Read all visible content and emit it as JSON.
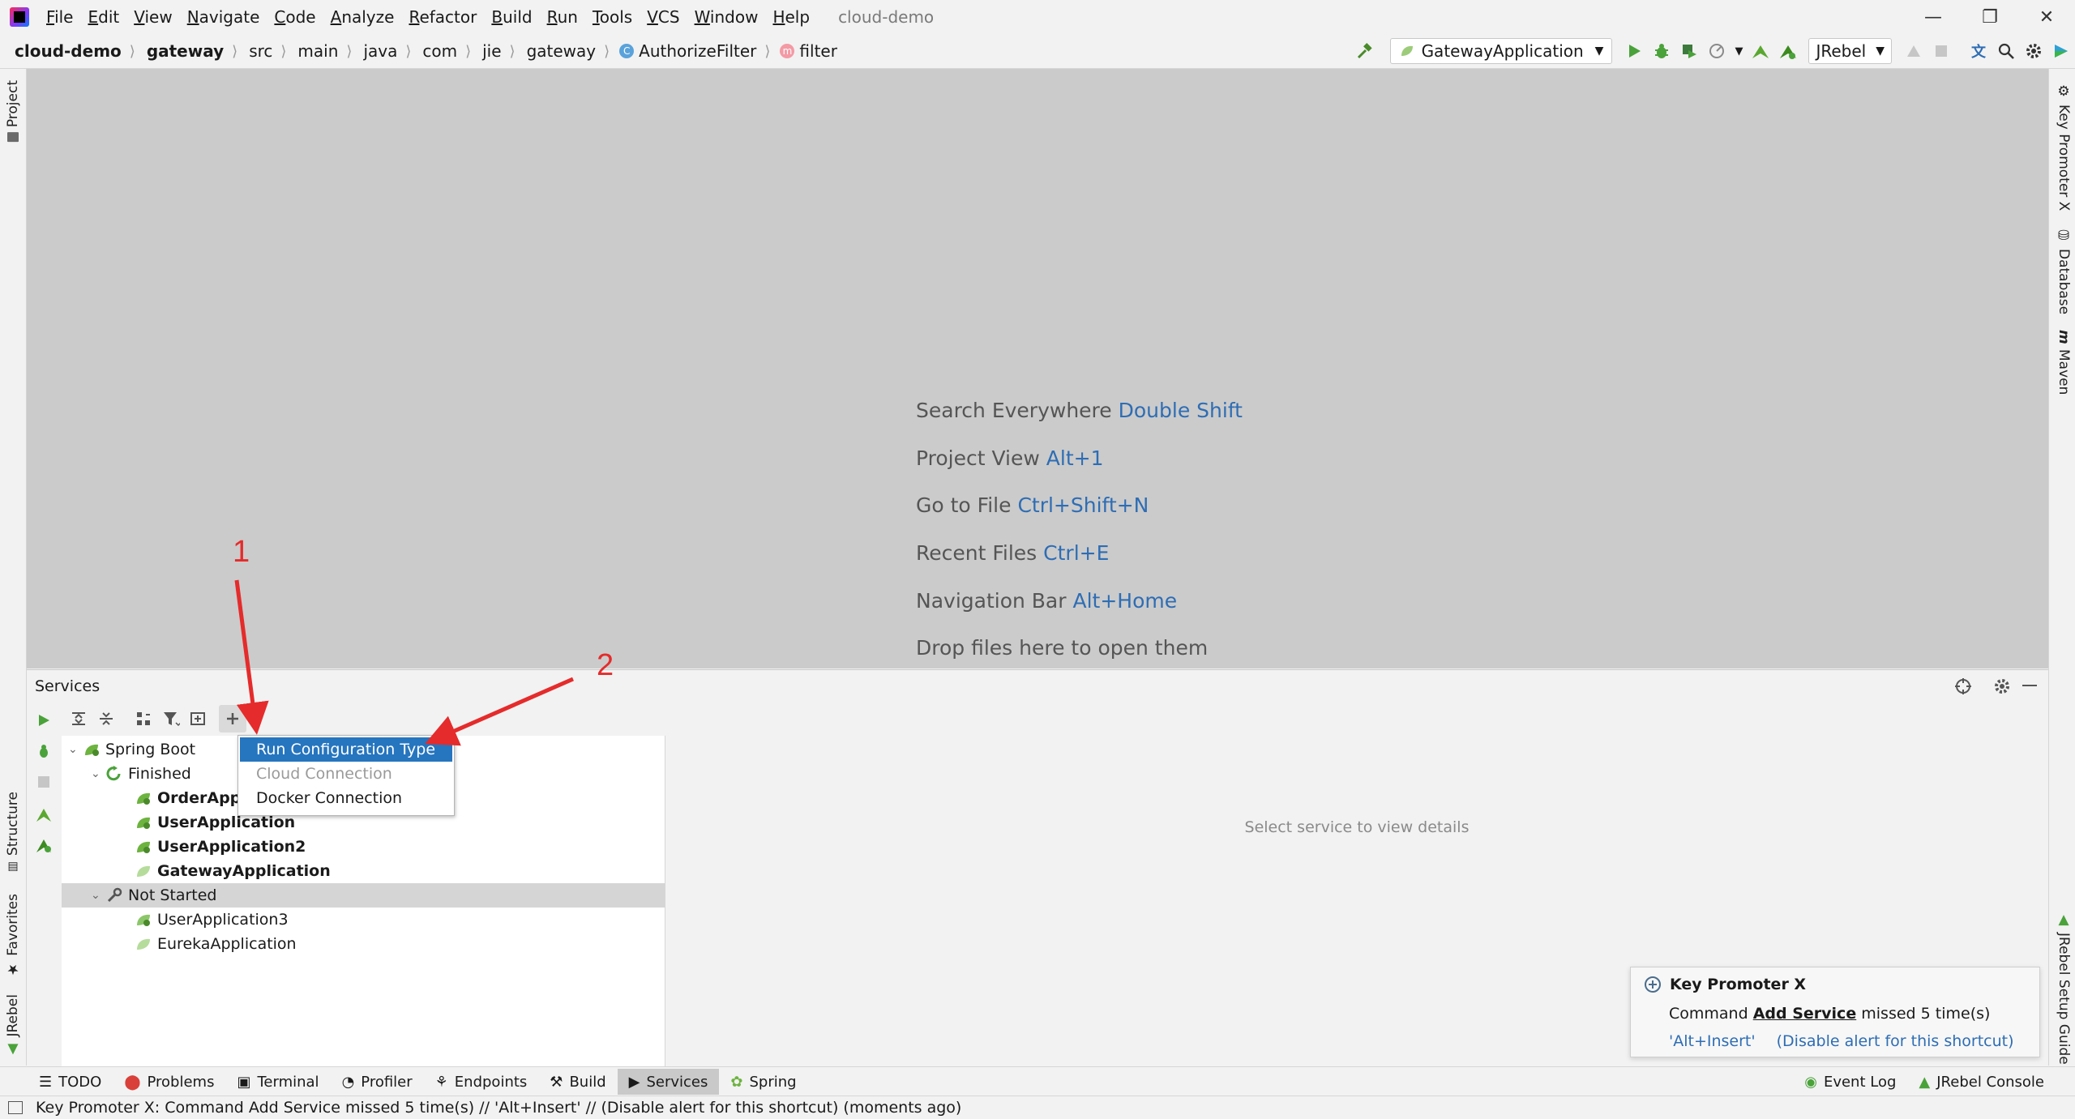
{
  "window": {
    "title": "cloud-demo",
    "menus": [
      "File",
      "Edit",
      "View",
      "Navigate",
      "Code",
      "Analyze",
      "Refactor",
      "Build",
      "Run",
      "Tools",
      "VCS",
      "Window",
      "Help"
    ]
  },
  "navbar": {
    "breadcrumbs": [
      "cloud-demo",
      "gateway",
      "src",
      "main",
      "java",
      "com",
      "jie",
      "gateway",
      "AuthorizeFilter",
      "filter"
    ],
    "run_config": "GatewayApplication",
    "jrebel_label": "JRebel"
  },
  "stripes": {
    "left": [
      "Project",
      "Structure",
      "Favorites",
      "JRebel"
    ],
    "right": [
      "Key Promoter X",
      "Database",
      "Maven",
      "JRebel Setup Guide"
    ]
  },
  "editor_hints": [
    {
      "text": "Search Everywhere",
      "shortcut": "Double Shift"
    },
    {
      "text": "Project View",
      "shortcut": "Alt+1"
    },
    {
      "text": "Go to File",
      "shortcut": "Ctrl+Shift+N"
    },
    {
      "text": "Recent Files",
      "shortcut": "Ctrl+E"
    },
    {
      "text": "Navigation Bar",
      "shortcut": "Alt+Home"
    },
    {
      "text": "Drop files here to open them",
      "shortcut": ""
    }
  ],
  "services": {
    "title": "Services",
    "empty_detail": "Select service to view details",
    "tree": {
      "root": "Spring Boot",
      "finished_group": "Finished",
      "finished": [
        "OrderAppli",
        "UserApplication",
        "UserApplication2",
        "GatewayApplication"
      ],
      "not_started_group": "Not Started",
      "not_started": [
        "UserApplication3",
        "EurekaApplication"
      ]
    },
    "popup": [
      "Run Configuration Type",
      "Cloud Connection",
      "Docker Connection"
    ]
  },
  "annotations": {
    "label_1": "1",
    "label_2": "2",
    "color": "#e52b2b"
  },
  "key_promoter": {
    "title": "Key Promoter X",
    "msg_prefix": "Command",
    "command": "Add Service",
    "msg_suffix": "missed 5 time(s)",
    "shortcut": "'Alt+Insert'",
    "disable": "(Disable alert for this shortcut)"
  },
  "bottom_tabs": [
    "TODO",
    "Problems",
    "Terminal",
    "Profiler",
    "Endpoints",
    "Build",
    "Services",
    "Spring"
  ],
  "bottom_right": [
    "Event Log",
    "JRebel Console"
  ],
  "status_text": "Key Promoter X: Command Add Service missed 5 time(s) // 'Alt+Insert' // (Disable alert for this shortcut) (moments ago)"
}
